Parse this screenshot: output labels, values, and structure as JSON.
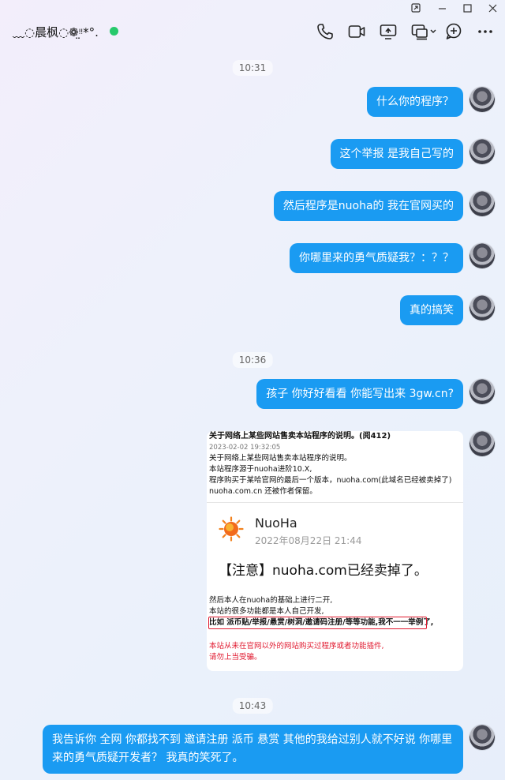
{
  "window": {
    "controls": [
      "pin-icon",
      "minimize-icon",
      "maximize-icon",
      "close-icon"
    ]
  },
  "header": {
    "title": "﹏◌晨枫◌❁ᵎ̤ᵎ*°.",
    "status_color": "#26c96b",
    "icons": [
      "phone-icon",
      "video-icon",
      "screen-share-icon",
      "remote-control-icon",
      "add-icon",
      "more-icon"
    ]
  },
  "colors": {
    "bubble": "#1a9bf2",
    "highlight": "#e0182e"
  },
  "times": [
    "10:31",
    "10:36",
    "10:43"
  ],
  "messages": [
    "什么你的程序？",
    "这个举报 是我自己写的",
    "然后程序是nuoha的 我在官网买的",
    "你哪里来的勇气质疑我？：？？",
    "真的搞笑",
    "孩子 你好好看看  你能写出来 3gw.cn?",
    "我告诉你 全网  你都找不到 邀请注册 派币 悬赏  其他的我给过别人就不好说  你哪里来的勇气质疑开发者？ 我真的笑死了。"
  ],
  "image_card": {
    "top_title": "关于网络上某些网站售卖本站程序的说明。(阅412)",
    "top_date": "2023-02-02 19:32:05",
    "top_lines": [
      "关于网络上某些网站售卖本站程序的说明。",
      "本站程序源于nuoha进阶10.X,",
      "程序购买于某哈官网的最后一个版本，nuoha.com(此域名已经被卖掉了)",
      "nuoha.com.cn 还被作者保留。"
    ],
    "name": "NuoHa",
    "date": "2022年08月22日 21:44",
    "notice": "【注意】nuoha.com已经卖掉了。",
    "body_lines": [
      "然后本人在nuoha的基础上进行二开,",
      "本站的很多功能都是本人自己开发,",
      "比如 派币贴/举报/悬赏/树洞/邀请码注册/等等功能,我不一一举例了,"
    ],
    "red_lines": [
      "本站从未在官网以外的网站购买过程序或者功能插件,",
      "请勿上当受骗。"
    ]
  }
}
